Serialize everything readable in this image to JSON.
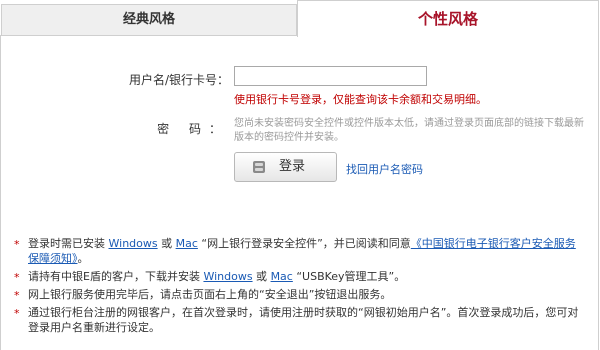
{
  "tabs": {
    "classic": "经典风格",
    "personal": "个性风格"
  },
  "form": {
    "user_label": "用户名/银行卡号：",
    "user_value": "",
    "user_hint": "使用银行卡号登录，仅能查询该卡余额和交易明细。",
    "pwd_label": "密 码：",
    "pwd_note": "您尚未安装密码安全控件或控件版本太低，请通过登录页面底部的链接下载最新版本的密码控件并安装。",
    "login_label": "登录",
    "forgot_link": "找回用户名密码"
  },
  "notes": [
    {
      "p1": "登录时需已安装 ",
      "link1": "Windows",
      "p2": " 或 ",
      "link2": "Mac",
      "p3": " “网上银行登录安全控件”，并已阅读和同意",
      "link3": "《中国银行电子银行客户安全服务保障须知》",
      "p4": "。"
    },
    {
      "p1": "请持有中银E盾的客户，下载并安装 ",
      "link1": "Windows",
      "p2": " 或 ",
      "link2": "Mac",
      "p3": " “USBKey管理工具”。"
    },
    {
      "text": "网上银行服务使用完毕后，请点击页面右上角的“安全退出”按钮退出服务。"
    },
    {
      "text": "通过银行柜台注册的网银客户，在首次登录时，请使用注册时获取的“网银初始用户名”。首次登录成功后，您可对登录用户名重新进行设定。"
    }
  ],
  "note_marker": "*",
  "colors": {
    "accent_red": "#a8142a",
    "link_blue": "#1a5ab4"
  }
}
